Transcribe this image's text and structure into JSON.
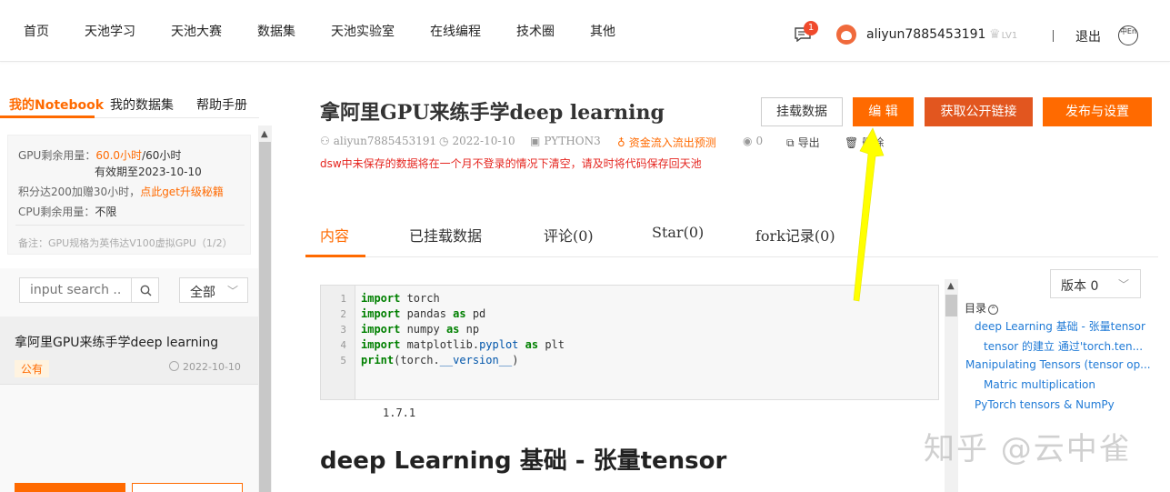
{
  "nav": {
    "items": [
      "首页",
      "天池学习",
      "天池大赛",
      "数据集",
      "天池实验室",
      "在线编程",
      "技术圈",
      "其他"
    ],
    "message_count": "1",
    "username": "aliyun7885453191",
    "level": "LV1",
    "logout": "退出",
    "lang": "中En"
  },
  "sidebar": {
    "tabs": [
      "我的Notebook",
      "我的数据集",
      "帮助手册"
    ],
    "gpu": {
      "gpu_label": "GPU剩余用量：",
      "gpu_used": "60.0小时",
      "gpu_total": "/60小时",
      "expiry": "有效期至2023-10-10",
      "points_text": "积分达200加赠30小时，",
      "upgrade_link": "点此get升级秘籍",
      "cpu_label": "CPU剩余用量：",
      "cpu_value": "不限",
      "note": "备注：GPU规格为英伟达V100虚拟GPU（1/2）"
    },
    "search": {
      "placeholder": "input search ..."
    },
    "filter": {
      "selected": "全部"
    },
    "notebook": {
      "title": "拿阿里GPU来练手学deep learning",
      "badge": "公有",
      "date": "2022-10-10"
    }
  },
  "main": {
    "title": "拿阿里GPU来练手学deep learning",
    "buttons": {
      "mount": "挂载数据",
      "edit": "编 辑",
      "public_link": "获取公开链接",
      "publish": "发布与设置"
    },
    "meta": {
      "author": "aliyun7885453191",
      "date": "2022-10-10",
      "kernel": "PYTHON3",
      "tag": "资金流入流出预测",
      "views": "0",
      "export": "导出",
      "delete": "删除"
    },
    "warning": "dsw中未保存的数据将在一个月不登录的情况下清空，请及时将代码保存回天池",
    "tabs": [
      "内容",
      "已挂载数据",
      "评论(0)",
      "Star(0)",
      "fork记录(0)"
    ],
    "code": {
      "line_numbers": [
        "1",
        "2",
        "3",
        "4",
        "5"
      ],
      "lines": [
        [
          {
            "t": "import",
            "c": "kw"
          },
          {
            "t": " torch",
            "c": ""
          }
        ],
        [
          {
            "t": "import",
            "c": "kw"
          },
          {
            "t": " pandas ",
            "c": ""
          },
          {
            "t": "as",
            "c": "kw"
          },
          {
            "t": " pd",
            "c": ""
          }
        ],
        [
          {
            "t": "import",
            "c": "kw"
          },
          {
            "t": " numpy ",
            "c": ""
          },
          {
            "t": "as",
            "c": "kw"
          },
          {
            "t": " np",
            "c": ""
          }
        ],
        [
          {
            "t": "import",
            "c": "kw"
          },
          {
            "t": " matplotlib.",
            "c": ""
          },
          {
            "t": "pyplot",
            "c": "fn"
          },
          {
            "t": " ",
            "c": ""
          },
          {
            "t": "as",
            "c": "kw"
          },
          {
            "t": " plt",
            "c": ""
          }
        ],
        [
          {
            "t": "print",
            "c": "kw"
          },
          {
            "t": "(torch.",
            "c": ""
          },
          {
            "t": "__version__",
            "c": "fn"
          },
          {
            "t": ")",
            "c": ""
          }
        ]
      ]
    },
    "output": "1.7.1",
    "section_heading": "deep Learning 基础 - 张量tensor",
    "version": "版本 0",
    "toc": {
      "title": "目录",
      "items": [
        "deep Learning 基础 - 张量tensor",
        "tensor 的建立 通过'torch.ten...",
        "Manipulating Tensors (tensor op...",
        "Matric multiplication",
        "PyTorch tensors & NumPy"
      ]
    }
  },
  "watermark": "知乎 @云中雀",
  "colors": {
    "accent": "#ff6a00",
    "warning": "#e5251f",
    "link": "#1f7ad6",
    "annotation_arrow": "#ffff00"
  }
}
